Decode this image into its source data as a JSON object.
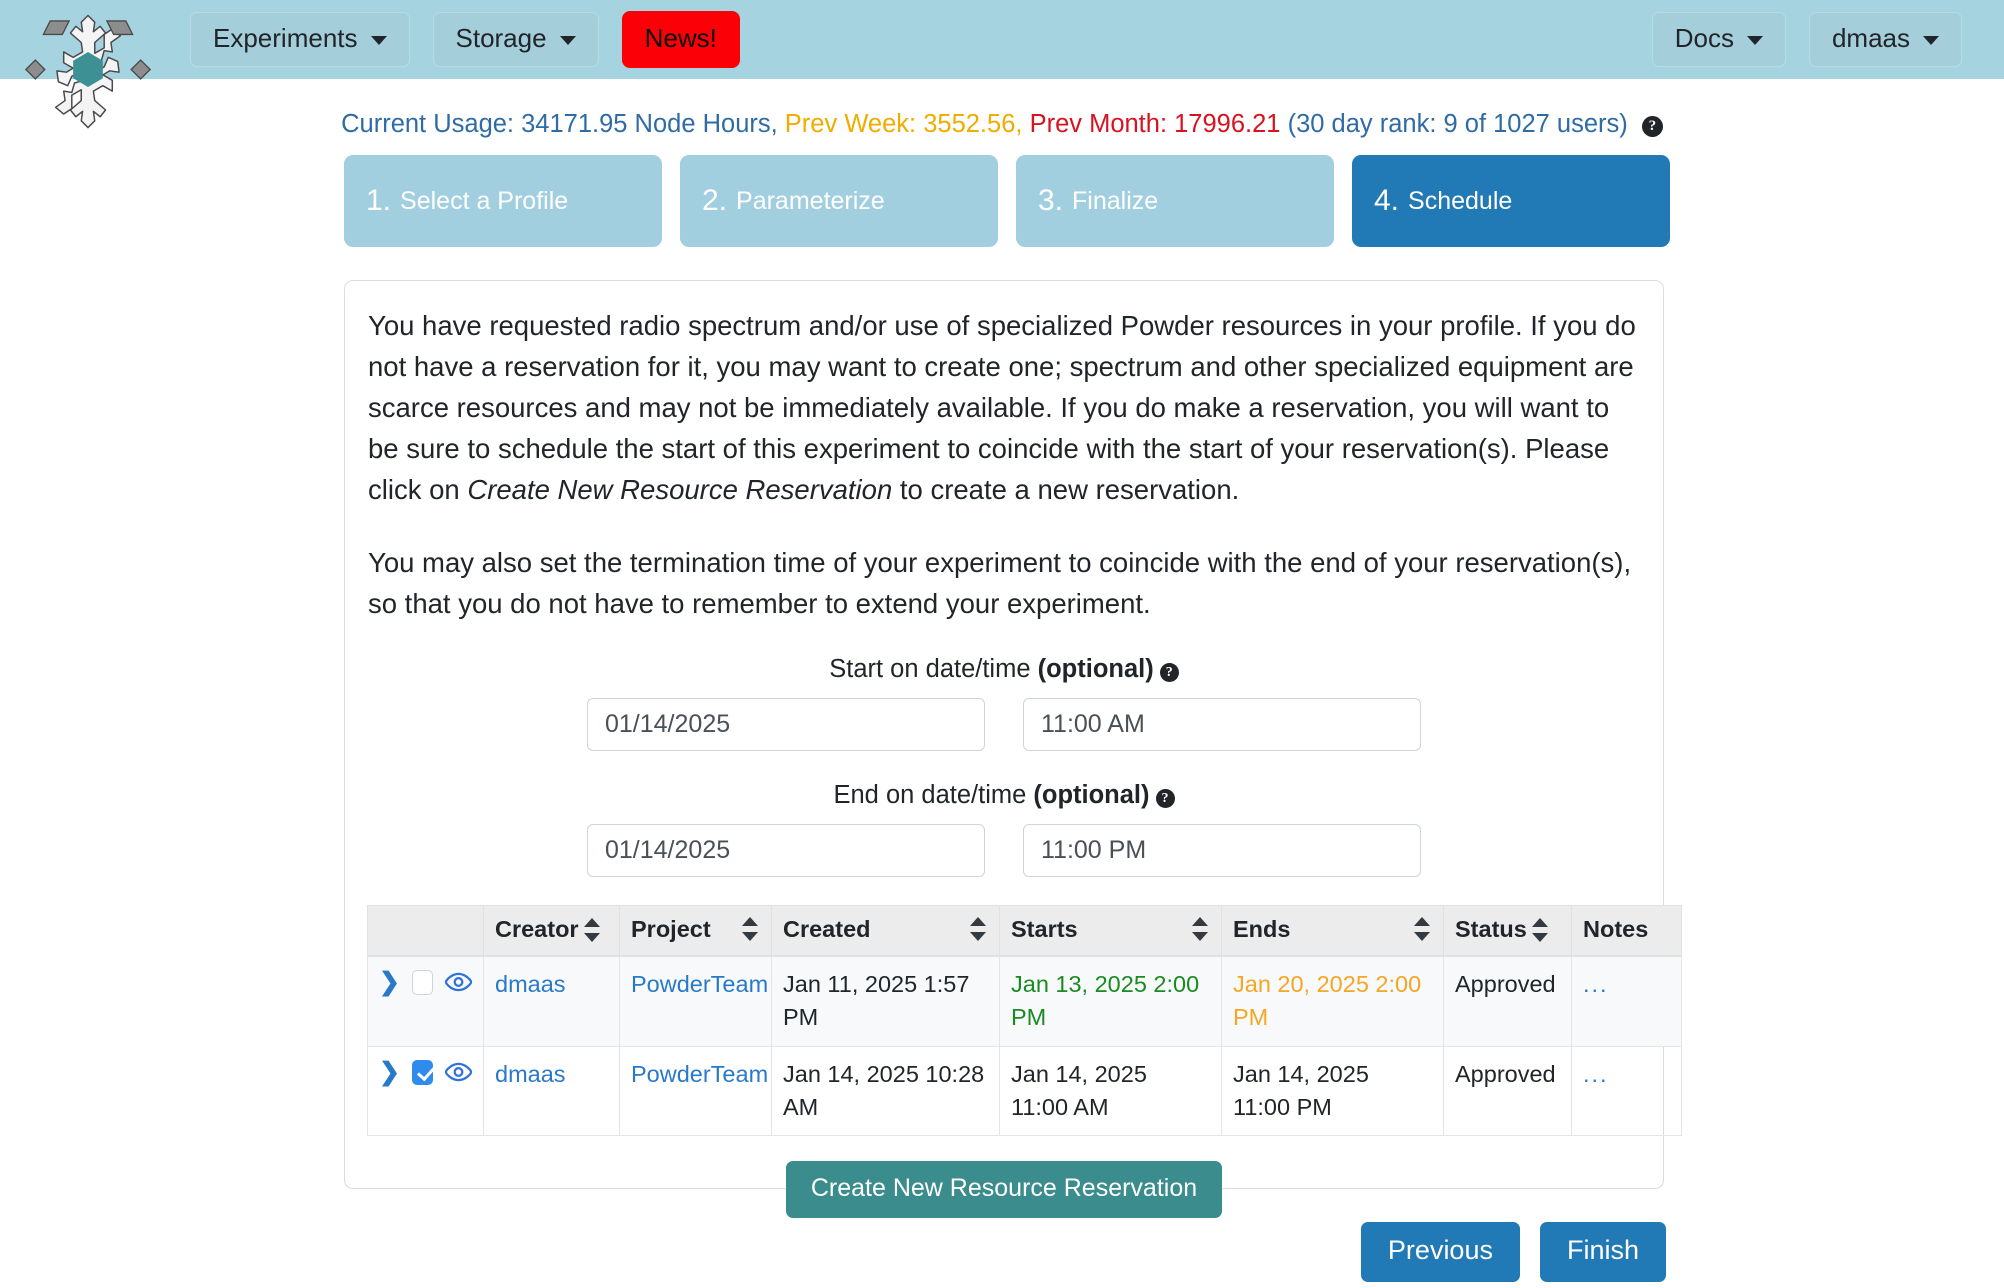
{
  "navbar": {
    "left_items": [
      {
        "label": "Experiments",
        "caret": true,
        "style": "normal",
        "icon": "chevron-down-icon"
      },
      {
        "label": "Storage",
        "caret": true,
        "style": "normal",
        "icon": "chevron-down-icon"
      },
      {
        "label": "News!",
        "caret": false,
        "style": "news"
      }
    ],
    "right_items": [
      {
        "label": "Docs",
        "caret": true,
        "icon": "chevron-down-icon"
      },
      {
        "label": "dmaas",
        "caret": true,
        "icon": "chevron-down-icon"
      }
    ],
    "logo_icon": "snowflake-logo-icon",
    "bg_color": "#a5d3e0",
    "news_color": "#fb0007"
  },
  "usage": {
    "current_label": "Current Usage: 34171.95 Node Hours,",
    "prev_week": "Prev Week: 3552.56,",
    "prev_month": "Prev Month: 17996.21",
    "rank": "(30 day rank: 9 of 1027 users)",
    "help_glyph": "?",
    "color_blue": "#2f6ca5",
    "color_orange": "#f0ad00",
    "color_red": "#d9121f"
  },
  "steps": [
    {
      "num": "1.",
      "label": "Select a Profile",
      "active": false
    },
    {
      "num": "2.",
      "label": "Parameterize",
      "active": false
    },
    {
      "num": "3.",
      "label": "Finalize",
      "active": false
    },
    {
      "num": "4.",
      "label": "Schedule",
      "active": true
    }
  ],
  "body": {
    "paragraph1_a": "You have requested radio spectrum and/or use of specialized Powder resources in your profile. If you do not have a reservation for it, you may want to create one; spectrum and other specialized equipment are scarce resources and may not be immediately available. If you do make a reservation, you will want to be sure to schedule the start of this experiment to coincide with the start of your reservation(s). Please click on ",
    "paragraph1_em": "Create New Resource Reservation",
    "paragraph1_b": " to create a new reservation.",
    "paragraph2": "You may also set the termination time of your experiment to coincide with the end of your reservation(s), so that you do not have to remember to extend your experiment."
  },
  "start_field": {
    "label_plain": "Start on date/time ",
    "label_bold": "(optional)",
    "help_glyph": "?",
    "date_value": "01/14/2025",
    "time_value": "11:00 AM"
  },
  "end_field": {
    "label_plain": "End on date/time ",
    "label_bold": "(optional)",
    "help_glyph": "?",
    "date_value": "01/14/2025",
    "time_value": "11:00 PM"
  },
  "table": {
    "columns": [
      "",
      "Creator",
      "Project",
      "Created",
      "Starts",
      "Ends",
      "Status",
      "Notes"
    ],
    "rows": [
      {
        "checked": false,
        "striped": true,
        "creator": "dmaas",
        "project": "PowderTeam",
        "created": "Jan 11, 2025 1:57 PM",
        "starts": "Jan 13, 2025 2:00 PM",
        "starts_color": "#1a8b22",
        "ends": "Jan 20, 2025 2:00 PM",
        "ends_color": "#f5a623",
        "status": "Approved",
        "notes": "..."
      },
      {
        "checked": true,
        "striped": false,
        "creator": "dmaas",
        "project": "PowderTeam",
        "created": "Jan 14, 2025 10:28 AM",
        "starts": "Jan 14, 2025 11:00 AM",
        "starts_color": "#212529",
        "ends": "Jan 14, 2025 11:00 PM",
        "ends_color": "#212529",
        "status": "Approved",
        "notes": "..."
      }
    ]
  },
  "buttons": {
    "create_reservation": "Create New Resource Reservation",
    "previous": "Previous",
    "finish": "Finish",
    "teal_color": "#3b8c8c",
    "blue_color": "#2179b5"
  }
}
